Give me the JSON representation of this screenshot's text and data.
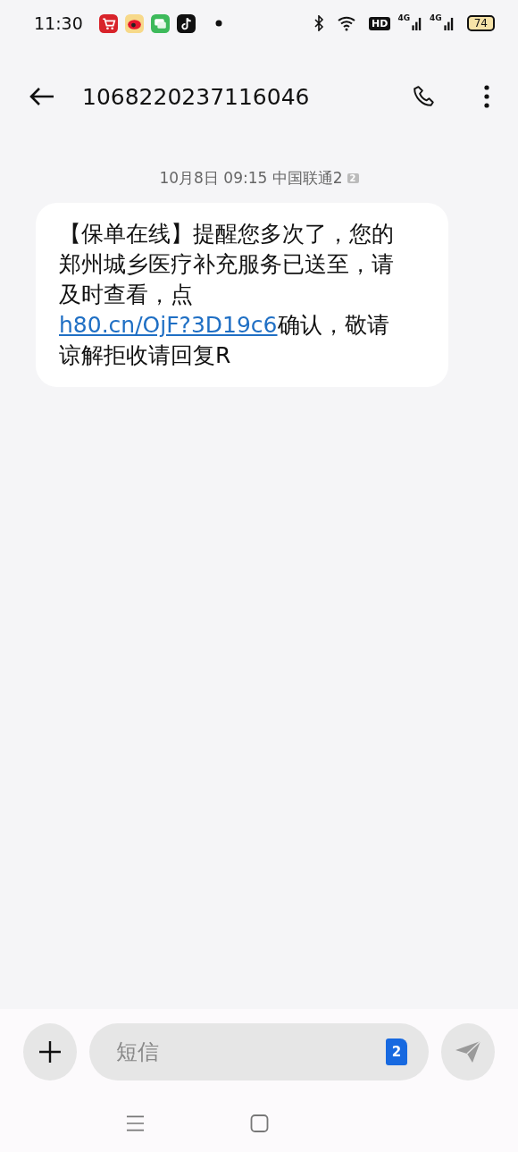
{
  "status_bar": {
    "time": "11:30",
    "network": [
      {
        "label": "HD"
      },
      {
        "label": "4G"
      },
      {
        "label": "4G"
      }
    ],
    "battery": "74"
  },
  "header": {
    "title": "1068220237116046"
  },
  "messages": [
    {
      "timestamp": "10月8日 09:15 中国联通2",
      "sim": "2",
      "text_before": "【保单在线】提醒您多次了，您的郑州城乡医疗补充服务已送至，请及时查看，点 ",
      "link": "h80.cn/OjF?3D19c6",
      "text_after": "确认，敬请谅解拒收请回复R"
    }
  ],
  "composer": {
    "placeholder": "短信",
    "sim": "2"
  }
}
